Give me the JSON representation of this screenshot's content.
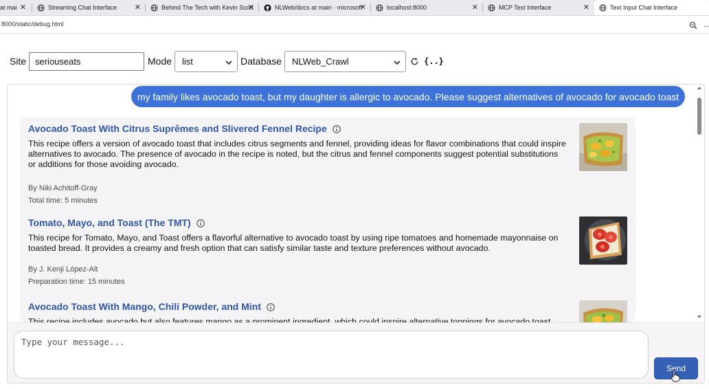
{
  "browser": {
    "tabs": [
      {
        "label": "at mai",
        "icon": "globe-icon"
      },
      {
        "label": "Streaming Chat Interface",
        "icon": "globe-icon"
      },
      {
        "label": "Behind The Tech with Kevin Scott",
        "icon": "globe-icon"
      },
      {
        "label": "NLWeb/docs at main · microsoft",
        "icon": "github-icon"
      },
      {
        "label": "localhost:8000",
        "icon": "globe-icon"
      },
      {
        "label": "MCP Test Interface",
        "icon": "globe-icon"
      },
      {
        "label": "Text Input Chat Interface",
        "icon": "globe-icon",
        "active": true
      }
    ],
    "url": "8000/static/debug.html"
  },
  "controls": {
    "site_label": "Site",
    "site_value": "seriouseats",
    "mode_label": "Mode",
    "mode_value": "list",
    "database_label": "Database",
    "database_value": "NLWeb_Crawl",
    "json_label": "{..}"
  },
  "chat": {
    "user_message": "my family likes avocado toast, but my daughter is allergic to avocado. Please suggest alternatives of avocado for avocado toast",
    "results": [
      {
        "title": "Avocado Toast With Citrus Suprêmes and Slivered Fennel Recipe",
        "description": "This recipe offers a version of avocado toast that includes citrus segments and fennel, providing ideas for flavor combinations that could inspire alternatives to avocado. The presence of avocado in the recipe is noted, but the citrus and fennel components suggest potential substitutions or additions for those avoiding avocado.",
        "author": "By Niki Achitoff-Gray",
        "time": "Total time: 5 minutes"
      },
      {
        "title": "Tomato, Mayo, and Toast (The TMT)",
        "description": "This recipe for Tomato, Mayo, and Toast offers a flavorful alternative to avocado toast by using ripe tomatoes and homemade mayonnaise on toasted bread. It provides a creamy and fresh option that can satisfy similar taste and texture preferences without avocado.",
        "author": "By J. Kenji López-Alt",
        "time": "Preparation time: 15 minutes"
      },
      {
        "title": "Avocado Toast With Mango, Chili Powder, and Mint",
        "description": "This recipe includes avocado but also features mango as a prominent ingredient, which could inspire alternative toppings for avocado toast."
      }
    ],
    "input_placeholder": "Type your message...",
    "send_label": "Send"
  },
  "colors": {
    "accent": "#3d73d8",
    "send_button": "#3560b5",
    "title_link": "#2f55a5"
  }
}
